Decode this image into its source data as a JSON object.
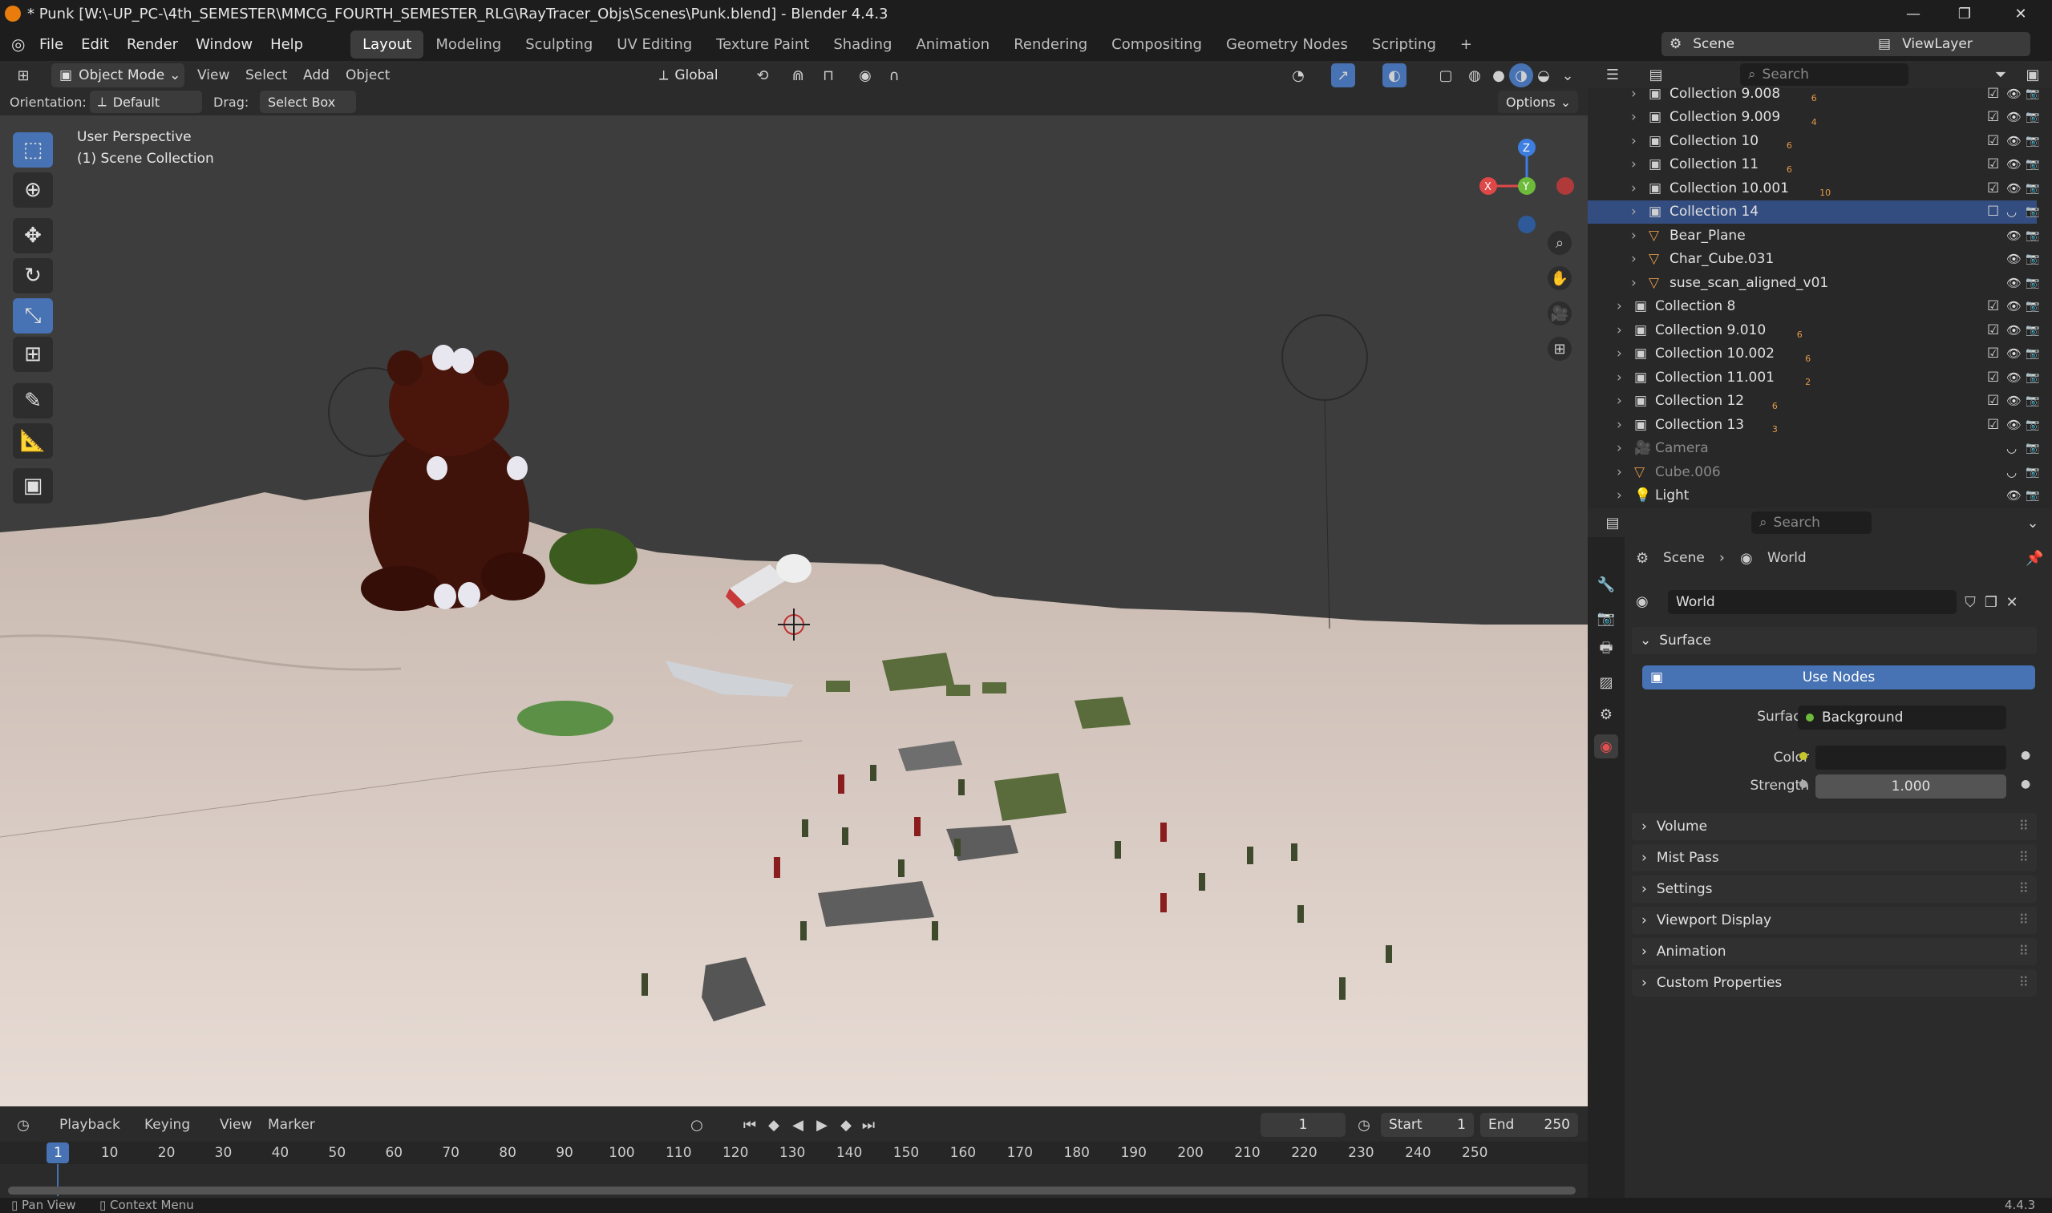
{
  "title": "* Punk [W:\\-UP_PC-\\4th_SEMESTER\\MMCG_FOURTH_SEMESTER_RLG\\RayTracer_Objs\\Scenes\\Punk.blend] - Blender 4.4.3",
  "menu": [
    "File",
    "Edit",
    "Render",
    "Window",
    "Help"
  ],
  "workspaces": [
    "Layout",
    "Modeling",
    "Sculpting",
    "UV Editing",
    "Texture Paint",
    "Shading",
    "Animation",
    "Rendering",
    "Compositing",
    "Geometry Nodes",
    "Scripting"
  ],
  "scene": "Scene",
  "viewlayer": "ViewLayer",
  "viewport": {
    "mode": "Object Mode",
    "menus": [
      "View",
      "Select",
      "Add",
      "Object"
    ],
    "transform": "Global",
    "orientation_label": "Orientation:",
    "orientation": "Default",
    "drag_label": "Drag:",
    "drag": "Select Box",
    "options": "Options",
    "overlay1": "User Perspective",
    "overlay2": "(1) Scene Collection"
  },
  "outliner": {
    "search": "Search",
    "rows": [
      {
        "name": "Collection 9.008",
        "indent": 2,
        "type": "col",
        "badge": "6",
        "vis": true
      },
      {
        "name": "Collection 9.009",
        "indent": 2,
        "type": "col",
        "badge": "4",
        "vis": true
      },
      {
        "name": "Collection 10",
        "indent": 2,
        "type": "col",
        "badge": "6",
        "vis": true
      },
      {
        "name": "Collection 11",
        "indent": 2,
        "type": "col",
        "badge": "6",
        "vis": true
      },
      {
        "name": "Collection 10.001",
        "indent": 2,
        "type": "col",
        "badge": "10",
        "vis": true
      },
      {
        "name": "Collection 14",
        "indent": 2,
        "type": "col",
        "badge": "",
        "vis": false,
        "sel": true
      },
      {
        "name": "Bear_Plane",
        "indent": 2,
        "type": "obj",
        "badge": "",
        "vis": true
      },
      {
        "name": "Char_Cube.031",
        "indent": 2,
        "type": "obj",
        "badge": "",
        "vis": true
      },
      {
        "name": "suse_scan_aligned_v01",
        "indent": 2,
        "type": "obj",
        "badge": "",
        "vis": true
      },
      {
        "name": "Collection 8",
        "indent": 1,
        "type": "col",
        "badge": "",
        "vis": true
      },
      {
        "name": "Collection 9.010",
        "indent": 1,
        "type": "col",
        "badge": "6",
        "vis": true
      },
      {
        "name": "Collection 10.002",
        "indent": 1,
        "type": "col",
        "badge": "6",
        "vis": true
      },
      {
        "name": "Collection 11.001",
        "indent": 1,
        "type": "col",
        "badge": "2",
        "vis": true
      },
      {
        "name": "Collection 12",
        "indent": 1,
        "type": "col",
        "badge": "6",
        "vis": true
      },
      {
        "name": "Collection 13",
        "indent": 1,
        "type": "col",
        "badge": "3",
        "vis": true
      },
      {
        "name": "Camera",
        "indent": 1,
        "type": "cam",
        "badge": "",
        "vis": false,
        "dim": true
      },
      {
        "name": "Cube.006",
        "indent": 1,
        "type": "obj",
        "badge": "",
        "vis": false,
        "dim": true
      },
      {
        "name": "Light",
        "indent": 1,
        "type": "light",
        "badge": "",
        "vis": true
      }
    ]
  },
  "properties": {
    "search": "Search",
    "crumb1": "Scene",
    "crumb2": "World",
    "world": "World",
    "panel_surface": "Surface",
    "use_nodes": "Use Nodes",
    "surface_label": "Surface",
    "surface_value": "Background",
    "color_label": "Color",
    "strength_label": "Strength",
    "strength_value": "1.000",
    "panels": [
      "Volume",
      "Mist Pass",
      "Settings",
      "Viewport Display",
      "Animation",
      "Custom Properties"
    ]
  },
  "timeline": {
    "menus": [
      "Playback",
      "Keying",
      "View",
      "Marker"
    ],
    "frame": "1",
    "start_label": "Start",
    "start": "1",
    "end_label": "End",
    "end": "250",
    "ticks": [
      "1",
      "10",
      "20",
      "30",
      "40",
      "50",
      "60",
      "70",
      "80",
      "90",
      "100",
      "110",
      "120",
      "130",
      "140",
      "150",
      "160",
      "170",
      "180",
      "190",
      "200",
      "210",
      "220",
      "230",
      "240",
      "250"
    ]
  },
  "status": {
    "left1": "Pan View",
    "left2": "Context Menu",
    "version": "4.4.3"
  },
  "colors": {
    "accent": "#4772b3",
    "selected_row": "#334d80",
    "red_axis": "#e04848",
    "green_axis": "#6dbb3a",
    "blue_axis": "#3d7ee0"
  }
}
